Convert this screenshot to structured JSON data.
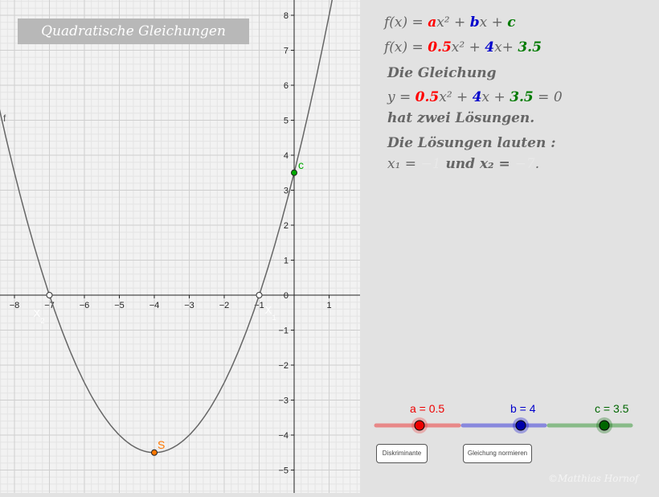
{
  "title": "Quadratische Gleichungen",
  "graph": {
    "x_ticks": [
      "−8",
      "−7",
      "−6",
      "−5",
      "−4",
      "−3",
      "−2",
      "−1",
      "",
      "1"
    ],
    "y_ticks": [
      "8",
      "7",
      "6",
      "5",
      "4",
      "3",
      "2",
      "1",
      "0",
      "−1",
      "−2",
      "−3",
      "−4",
      "−5"
    ],
    "function_label": "f",
    "point_labels": {
      "x2": "X",
      "x2_sub": "2",
      "x1": "X",
      "x1_sub": "1",
      "c": "c",
      "s": "S"
    },
    "colors": {
      "curve": "#666666",
      "point_c": "#00aa00",
      "point_s": "#ff7700",
      "label_s": "#ff7700",
      "label_c": "#00aa00"
    }
  },
  "algebra": {
    "general_prefix": "f(x) = ",
    "general_a": "a",
    "general_mid": "x² + ",
    "general_b": "b",
    "general_mid2": "x + ",
    "general_c": "c",
    "specific_prefix": "f(x) = ",
    "specific_a": "0.5",
    "specific_mid": "x² + ",
    "specific_b": "4",
    "specific_mid2": "x+ ",
    "specific_c": "3.5",
    "line1": "Die Gleichung",
    "eq_prefix": "y = ",
    "eq_a": "0.5",
    "eq_mid": "x² + ",
    "eq_b": "4",
    "eq_mid2": "x + ",
    "eq_c": "3.5",
    "eq_suffix": " = 0",
    "line3": "hat zwei Lösungen.",
    "line4": "Die Lösungen lauten :",
    "sol_x1": "x₁ = ",
    "sol_v1": "−1",
    "sol_and": " und x₂ = ",
    "sol_v2": "−7",
    "sol_end": "."
  },
  "sliders": [
    {
      "label": "a = 0.5",
      "value": 0.5,
      "color": "#ee3333",
      "track": "#e88888"
    },
    {
      "label": "b = 4",
      "value": 4,
      "color": "#0000aa",
      "track": "#8888dd"
    },
    {
      "label": "c = 3.5",
      "value": 3.5,
      "color": "#006600",
      "track": "#88bb88"
    }
  ],
  "buttons": {
    "diskriminante": "Diskriminante",
    "normieren": "Gleichung normieren"
  },
  "watermark": "©Matthias Hornof"
}
